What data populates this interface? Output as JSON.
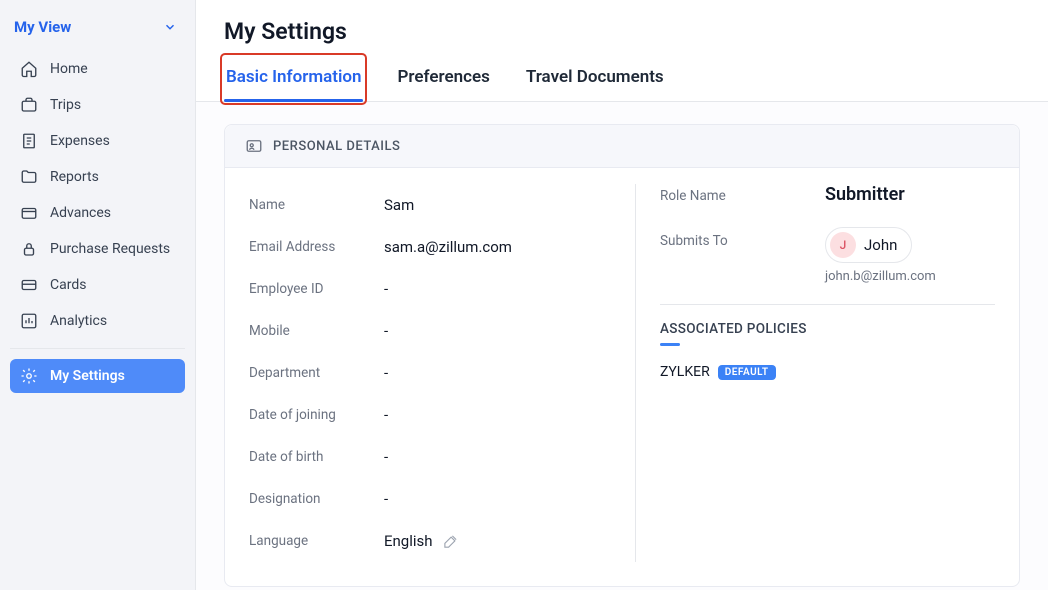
{
  "sidebar": {
    "title": "My View",
    "items": [
      {
        "label": "Home",
        "icon": "home-icon",
        "active": false
      },
      {
        "label": "Trips",
        "icon": "briefcase-icon",
        "active": false
      },
      {
        "label": "Expenses",
        "icon": "receipt-icon",
        "active": false
      },
      {
        "label": "Reports",
        "icon": "folder-icon",
        "active": false
      },
      {
        "label": "Advances",
        "icon": "wallet-icon",
        "active": false
      },
      {
        "label": "Purchase Requests",
        "icon": "lock-icon",
        "active": false
      },
      {
        "label": "Cards",
        "icon": "card-icon",
        "active": false
      },
      {
        "label": "Analytics",
        "icon": "chart-icon",
        "active": false
      },
      {
        "label": "My Settings",
        "icon": "gear-icon",
        "active": true
      }
    ]
  },
  "page": {
    "title": "My Settings",
    "tabs": [
      {
        "label": "Basic Information",
        "active": true,
        "highlight": true
      },
      {
        "label": "Preferences",
        "active": false
      },
      {
        "label": "Travel Documents",
        "active": false
      }
    ]
  },
  "personal": {
    "section_title": "PERSONAL DETAILS",
    "fields": [
      {
        "label": "Name",
        "value": "Sam"
      },
      {
        "label": "Email Address",
        "value": "sam.a@zillum.com"
      },
      {
        "label": "Employee ID",
        "value": "-"
      },
      {
        "label": "Mobile",
        "value": "-"
      },
      {
        "label": "Department",
        "value": "-"
      },
      {
        "label": "Date of joining",
        "value": "-"
      },
      {
        "label": "Date of birth",
        "value": "-"
      },
      {
        "label": "Designation",
        "value": "-"
      },
      {
        "label": "Language",
        "value": "English",
        "editable": true
      }
    ]
  },
  "role": {
    "label": "Role Name",
    "value": "Submitter",
    "submits_label": "Submits To",
    "submits_to": {
      "initial": "J",
      "name": "John",
      "email": "john.b@zillum.com"
    }
  },
  "policies": {
    "title": "ASSOCIATED POLICIES",
    "items": [
      {
        "name": "ZYLKER",
        "default": true,
        "default_label": "DEFAULT"
      }
    ]
  }
}
